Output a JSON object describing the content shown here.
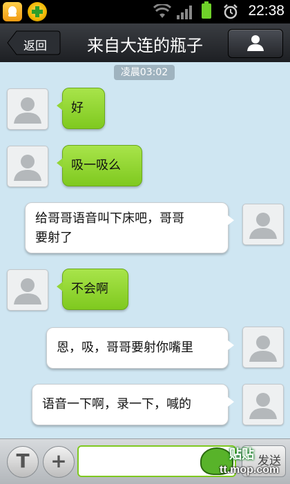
{
  "status_bar": {
    "time": "22:38",
    "icons": [
      "qq-notification-icon",
      "security-app-icon",
      "wifi-icon",
      "signal-icon",
      "battery-icon",
      "alarm-icon"
    ]
  },
  "header": {
    "back_label": "返回",
    "title": "来自大连的瓶子",
    "profile_icon": "person-icon"
  },
  "chat": {
    "timestamp": "凌晨03:02",
    "messages": [
      {
        "side": "left",
        "text": "好"
      },
      {
        "side": "left",
        "text": "吸一吸么"
      },
      {
        "side": "right",
        "text_line1": "给哥哥语音叫下床吧，哥哥",
        "text_line2": "要射了"
      },
      {
        "side": "left",
        "text": "不会啊"
      },
      {
        "side": "right",
        "text": "恩，吸，哥哥要射你嘴里"
      },
      {
        "side": "right",
        "text": "语音一下啊，录一下，喊的"
      }
    ]
  },
  "input_bar": {
    "text_mode_label": "T",
    "plus_label": "+",
    "input_value": "",
    "send_label": "发送"
  },
  "watermark": {
    "line1": "贴贴",
    "line2": "tt.mop.com"
  },
  "colors": {
    "chat_background": "#cfe6f2",
    "green_bubble": "#93d636",
    "header_dark": "#1d1f23"
  }
}
